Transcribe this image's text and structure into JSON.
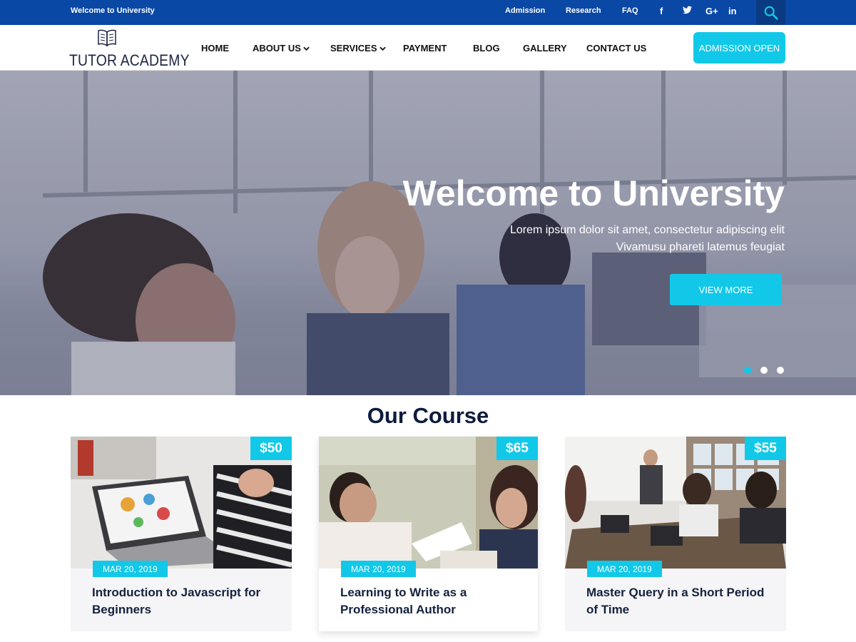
{
  "topbar": {
    "welcome": "Welcome to University",
    "links": [
      "Admission",
      "Research",
      "FAQ"
    ],
    "social": [
      "facebook-icon",
      "twitter-icon",
      "google-plus-icon",
      "linkedin-icon"
    ],
    "social_glyphs": [
      "f",
      "t",
      "G+",
      "in"
    ]
  },
  "header": {
    "logo_text": "TUTOR ACADEMY",
    "nav": [
      {
        "label": "HOME"
      },
      {
        "label": "ABOUT US"
      },
      {
        "label": "SERVICES"
      },
      {
        "label": "PAYMENT"
      },
      {
        "label": "BLOG"
      },
      {
        "label": "GALLERY"
      },
      {
        "label": "CONTACT US"
      }
    ],
    "cta_label": "ADMISSION OPEN"
  },
  "hero": {
    "title": "Welcome to University",
    "subtitle_line1": "Lorem ipsum dolor sit amet, consectetur adipiscing elit",
    "subtitle_line2": "Vivamusu phareti latemus feugiat",
    "button_label": "VIEW MORE",
    "slide_count": 3,
    "active_slide": 0
  },
  "courses": {
    "section_title": "Our Course",
    "cards": [
      {
        "price": "$50",
        "date": "MAR 20, 2019",
        "title": "Introduction to Javascript for Beginners"
      },
      {
        "price": "$65",
        "date": "MAR 20, 2019",
        "title": "Learning to Write as a Professional Author"
      },
      {
        "price": "$55",
        "date": "MAR 20, 2019",
        "title": "Master Query in a Short Period of Time"
      }
    ]
  },
  "colors": {
    "topbar": "#0a48a6",
    "accent": "#12c8e8",
    "heading": "#0d1b3e"
  }
}
